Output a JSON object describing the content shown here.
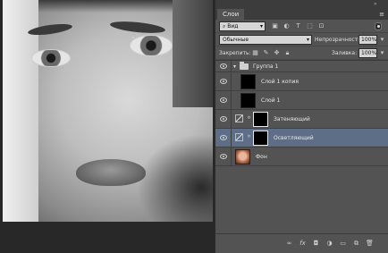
{
  "panel": {
    "tab": "Слои",
    "menu_glyph": "≡",
    "filter": {
      "value": "Вид",
      "icons": [
        "image-filter-icon",
        "adjustment-filter-icon",
        "type-filter-icon",
        "shape-filter-icon",
        "smart-object-filter-icon"
      ]
    },
    "blend": {
      "mode": "Обычные",
      "opacity_label": "Непрозрачность:",
      "opacity": "100%"
    },
    "lock": {
      "label": "Закрепить:",
      "fill_label": "Заливка:",
      "fill": "100%"
    }
  },
  "layers": [
    {
      "name": "Группа 1",
      "type": "group"
    },
    {
      "name": "Слой 1 копия",
      "type": "layer"
    },
    {
      "name": "Слой 1",
      "type": "layer"
    },
    {
      "name": "Затеняющий",
      "type": "adjustment"
    },
    {
      "name": "Осветляющий",
      "type": "adjustment",
      "selected": true
    },
    {
      "name": "Фон",
      "type": "background"
    }
  ],
  "bottom_bar": [
    "link-icon",
    "fx",
    "mask-icon",
    "adjustment-icon",
    "folder-icon",
    "new-layer-icon",
    "trash-icon"
  ],
  "colors": {
    "panel": "#535353",
    "selected": "#5f6e87",
    "canvas": "#282828"
  }
}
